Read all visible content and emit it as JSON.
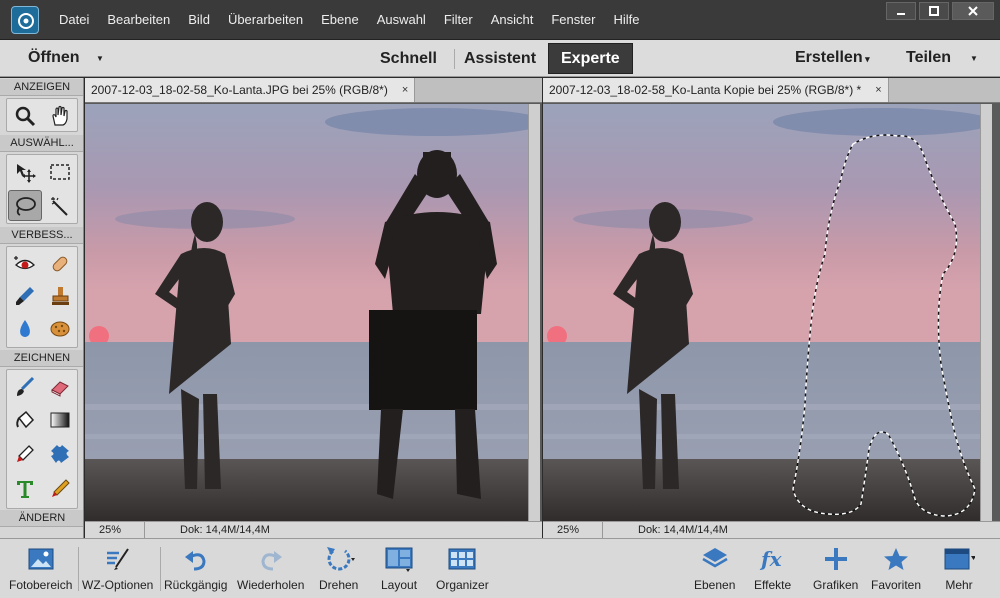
{
  "menu": [
    "Datei",
    "Bearbeiten",
    "Bild",
    "Überarbeiten",
    "Ebene",
    "Auswahl",
    "Filter",
    "Ansicht",
    "Fenster",
    "Hilfe"
  ],
  "modebar": {
    "open_label": "Öffnen",
    "modes": [
      "Schnell",
      "Assistent",
      "Experte"
    ],
    "active_mode": "Experte",
    "create_label": "Erstellen",
    "share_label": "Teilen"
  },
  "tools": {
    "sections": [
      "ANZEIGEN",
      "AUSWÄHL...",
      "VERBESS...",
      "ZEICHNEN",
      "ÄNDERN"
    ]
  },
  "docs": [
    {
      "tab_title": "2007-12-03_18-02-58_Ko-Lanta.JPG bei 25% (RGB/8*)",
      "close": "×",
      "zoom": "25%",
      "dok": "Dok: 14,4M/14,4M"
    },
    {
      "tab_title": "2007-12-03_18-02-58_Ko-Lanta Kopie bei 25% (RGB/8*) *",
      "close": "×",
      "zoom": "25%",
      "dok": "Dok: 14,4M/14,4M"
    }
  ],
  "bottombar": {
    "left": [
      "Fotobereich",
      "WZ-Optionen",
      "Rückgängig",
      "Wiederholen",
      "Drehen",
      "Layout",
      "Organizer"
    ],
    "right": [
      "Ebenen",
      "Effekte",
      "Grafiken",
      "Favoriten",
      "Mehr"
    ]
  }
}
